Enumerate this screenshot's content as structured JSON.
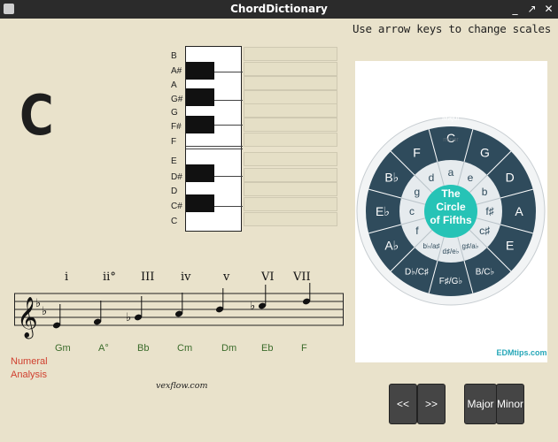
{
  "window": {
    "title": "ChordDictionary",
    "controls": [
      "_",
      "↗",
      "✕"
    ]
  },
  "hint": "Use arrow keys to change scales",
  "chord": {
    "name": "C"
  },
  "piano": {
    "note_labels": [
      "B",
      "A#",
      "A",
      "G#",
      "G",
      "F#",
      "F",
      "E",
      "D#",
      "D",
      "C#",
      "C"
    ]
  },
  "scale": {
    "numerals": [
      "i",
      "ii°",
      "III",
      "iv",
      "v",
      "VI",
      "VII"
    ],
    "chords": [
      "Gm",
      "A°",
      "Bb",
      "Cm",
      "Dm",
      "Eb",
      "F"
    ],
    "key_signature": "two flats",
    "numeral_label_line1": "Numeral",
    "numeral_label_line2": "Analysis",
    "credit": "vexflow.com"
  },
  "circle_of_fifths": {
    "center_line1": "The",
    "center_line2": "Circle",
    "center_line3": "of Fifths",
    "major_keys": [
      "C",
      "G",
      "D",
      "A",
      "E",
      "B/C♭",
      "F♯/G♭",
      "D♭/C♯",
      "A♭",
      "E♭",
      "B♭",
      "F"
    ],
    "minor_keys": [
      "a",
      "e",
      "b",
      "f♯",
      "c♯",
      "g♯/a♭",
      "d♯/e♭",
      "b♭/a♯",
      "f",
      "c",
      "g",
      "d"
    ],
    "major_label": "Major",
    "minor_label": "minor",
    "brand": "EDMtips.com",
    "colors": {
      "outer": "#2f4b5c",
      "inner": "#e6ebee",
      "center": "#26c3b6"
    }
  },
  "buttons": {
    "prev": "<<",
    "next": ">>",
    "major": "Major",
    "minor": "Minor"
  }
}
